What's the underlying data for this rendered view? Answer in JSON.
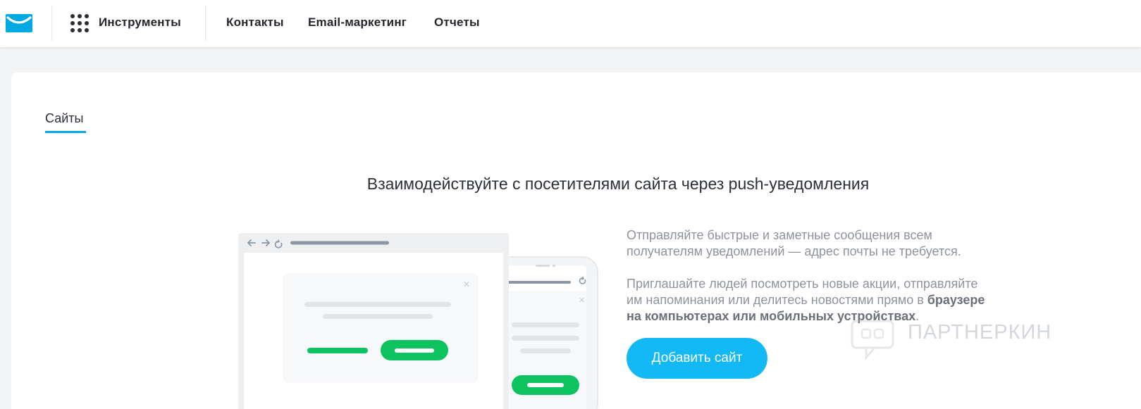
{
  "nav": {
    "tools_label": "Инструменты",
    "items": [
      {
        "label": "Контакты"
      },
      {
        "label": "Email-маркетинг"
      },
      {
        "label": "Отчеты"
      }
    ]
  },
  "tabs": [
    {
      "label": "Сайты",
      "active": true
    }
  ],
  "main": {
    "headline": "Взаимодействуйте с посетителями сайта через push-уведомления",
    "desc1_line1": "Отправляйте быстрые и заметные сообщения всем",
    "desc1_line2": "получателям уведомлений — адрес почты не требуется.",
    "desc2_line1": "Приглашайте людей посмотреть новые акции, отправляйте",
    "desc2_line2_text": "им напоминания или делитесь новостями прямо в ",
    "desc2_line2_bold": "браузере",
    "desc2_line3_bold": "на компьютерах или мобильных устройствах",
    "desc2_line3_end": ".",
    "add_site_button": "Добавить сайт"
  },
  "watermark": {
    "text": "ПАРТНЕРКИН"
  },
  "icons": {
    "logo": "envelope-logo-icon",
    "apps": "grid-dots-icon",
    "illustration": "browser-and-phone-notification-illustration"
  },
  "colors": {
    "brand_blue": "#00a9e4",
    "button_blue": "#12b9f4",
    "green": "#0cc35f",
    "nav_text": "#23262b",
    "muted_text": "#8e939b"
  }
}
